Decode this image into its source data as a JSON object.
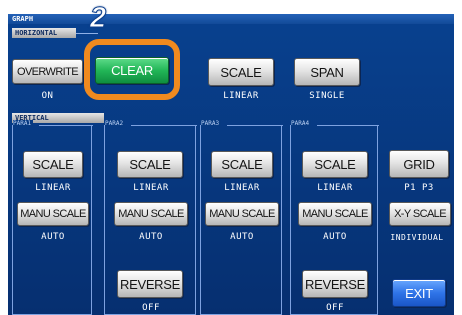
{
  "title": "GRAPH",
  "step_number": "2",
  "horizontal": {
    "section_label": "HORIZONTAL",
    "overwrite": {
      "label": "OVERWRITE",
      "value": "ON"
    },
    "clear": {
      "label": "CLEAR"
    },
    "scale": {
      "label": "SCALE",
      "value": "LINEAR"
    },
    "span": {
      "label": "SPAN",
      "value": "SINGLE"
    }
  },
  "vertical": {
    "section_label": "VERTICAL",
    "paras": [
      {
        "label": "PARA1",
        "scale_label": "SCALE",
        "scale_value": "LINEAR",
        "manu_label": "MANU SCALE",
        "manu_value": "AUTO"
      },
      {
        "label": "PARA2",
        "scale_label": "SCALE",
        "scale_value": "LINEAR",
        "manu_label": "MANU SCALE",
        "manu_value": "AUTO",
        "reverse_label": "REVERSE",
        "reverse_value": "OFF"
      },
      {
        "label": "PARA3",
        "scale_label": "SCALE",
        "scale_value": "LINEAR",
        "manu_label": "MANU SCALE",
        "manu_value": "AUTO"
      },
      {
        "label": "PARA4",
        "scale_label": "SCALE",
        "scale_value": "LINEAR",
        "manu_label": "MANU SCALE",
        "manu_value": "AUTO",
        "reverse_label": "REVERSE",
        "reverse_value": "OFF"
      }
    ],
    "grid": {
      "label": "GRID",
      "value": "P1 P3"
    },
    "xy_scale": {
      "label": "X-Y SCALE",
      "value": "INDIVIDUAL"
    }
  },
  "exit": {
    "label": "EXIT"
  },
  "colors": {
    "background": "#083a86",
    "highlight": "#f08a1f",
    "clear_button": "#22b657",
    "exit_button": "#2f74e8"
  }
}
